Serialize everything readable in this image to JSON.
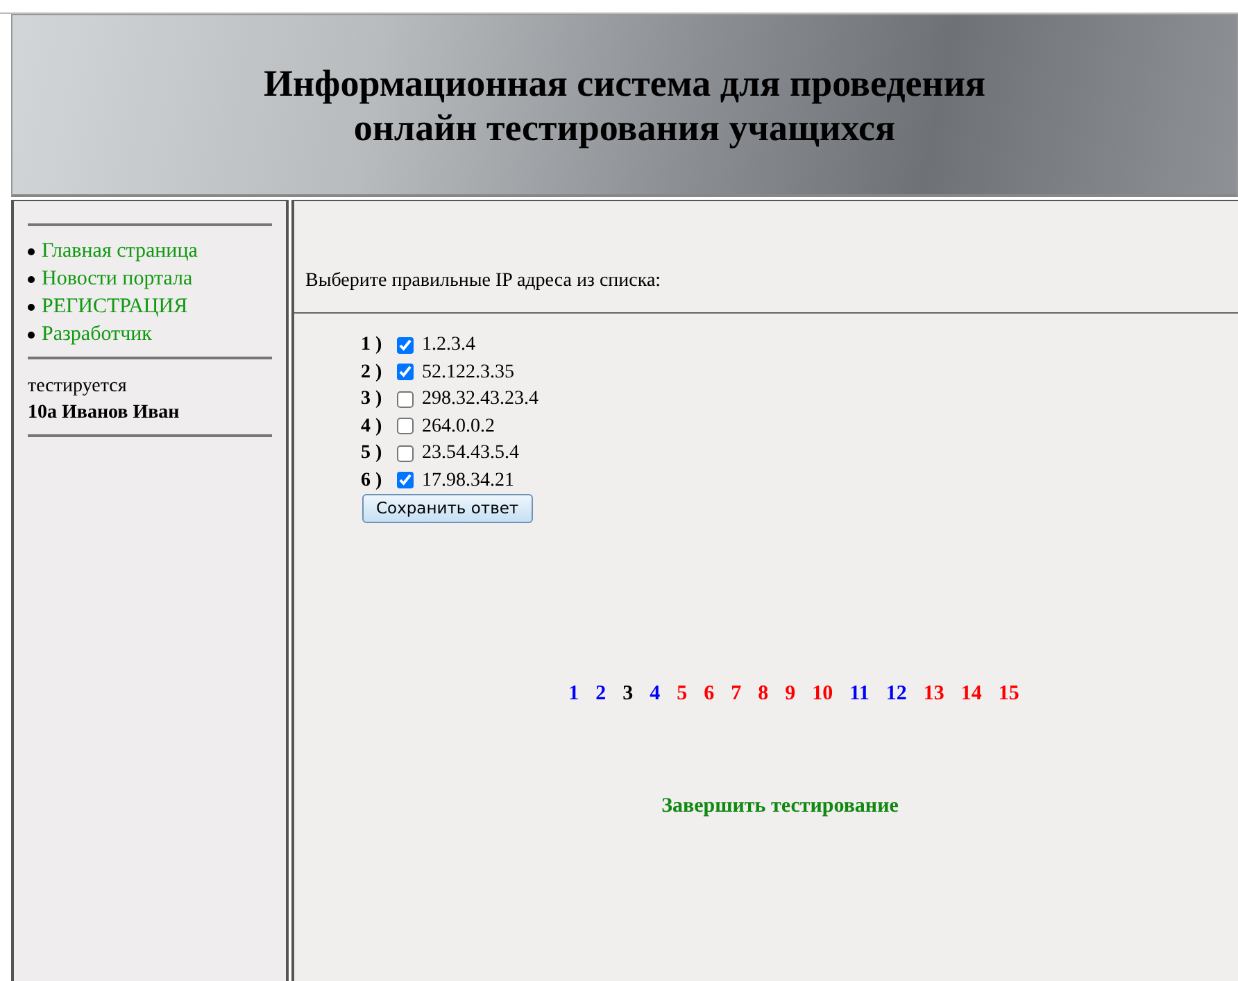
{
  "header": {
    "title": "Информационная система для проведения",
    "subtitle": "онлайн тестирования учащихся"
  },
  "sidebar": {
    "links": [
      "Главная страница",
      "Новости портала",
      "РЕГИСТРАЦИЯ",
      "Разработчик"
    ],
    "status_label": "тестируется",
    "student": "10а Иванов Иван"
  },
  "question": {
    "prompt": "Выберите правильные IP адреса из списка:",
    "options": [
      {
        "number": "1 )",
        "text": "1.2.3.4",
        "checked": true
      },
      {
        "number": "2 )",
        "text": "52.122.3.35",
        "checked": true
      },
      {
        "number": "3 )",
        "text": "298.32.43.23.4",
        "checked": false
      },
      {
        "number": "4 )",
        "text": "264.0.0.2",
        "checked": false
      },
      {
        "number": "5 )",
        "text": "23.54.43.5.4",
        "checked": false
      },
      {
        "number": "6 )",
        "text": "17.98.34.21",
        "checked": true
      }
    ],
    "save_button": "Сохранить ответ"
  },
  "question_links": [
    {
      "label": "1",
      "color": "#0000ff"
    },
    {
      "label": "2",
      "color": "#0000ff"
    },
    {
      "label": "3",
      "color": "#000000"
    },
    {
      "label": "4",
      "color": "#0000ff"
    },
    {
      "label": "5",
      "color": "#ff0000"
    },
    {
      "label": "6",
      "color": "#ff0000"
    },
    {
      "label": "7",
      "color": "#ff0000"
    },
    {
      "label": "8",
      "color": "#ff0000"
    },
    {
      "label": "9",
      "color": "#ff0000"
    },
    {
      "label": "10",
      "color": "#ff0000"
    },
    {
      "label": "11",
      "color": "#0000ff"
    },
    {
      "label": "12",
      "color": "#0000ff"
    },
    {
      "label": "13",
      "color": "#ff0000"
    },
    {
      "label": "14",
      "color": "#ff0000"
    },
    {
      "label": "15",
      "color": "#ff0000"
    }
  ],
  "finish_link": "Завершить тестирование"
}
